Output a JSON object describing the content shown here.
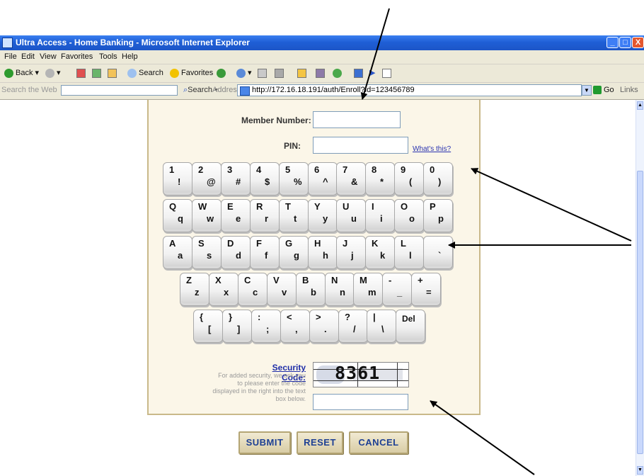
{
  "window": {
    "title": "Ultra Access - Home Banking - Microsoft Internet Explorer",
    "buttons": {
      "minimize": "_",
      "maximize": "□",
      "close": "X"
    }
  },
  "menu": [
    "File",
    "Edit",
    "View",
    "Favorites",
    "Tools",
    "Help"
  ],
  "toolbar": {
    "back": "Back",
    "search": "Search",
    "favorites": "Favorites"
  },
  "addressbar": {
    "search_web_placeholder": "Search the Web",
    "search_button": "Search",
    "address_label": "Address",
    "url": "http://172.16.18.191/auth/Enroll?id=123456789",
    "go": "Go",
    "links": "Links"
  },
  "form": {
    "member_number_label": "Member Number:",
    "pin_label": "PIN:",
    "whats_this": "What's this?",
    "security_code_label": "Security Code:",
    "security_code_desc": "For added security, we ask you to please enter the code displayed in the right into the text box below.",
    "captcha_text": "8361",
    "buttons": {
      "submit": "SUBMIT",
      "reset": "RESET",
      "cancel": "CANCEL"
    }
  },
  "keyboard": {
    "rows": [
      [
        [
          "1",
          "!"
        ],
        [
          "2",
          "@"
        ],
        [
          "3",
          "#"
        ],
        [
          "4",
          "$"
        ],
        [
          "5",
          "%"
        ],
        [
          "6",
          "^"
        ],
        [
          "7",
          "&"
        ],
        [
          "8",
          "*"
        ],
        [
          "9",
          "("
        ],
        [
          "0",
          ")"
        ]
      ],
      [
        [
          "Q",
          "q"
        ],
        [
          "W",
          "w"
        ],
        [
          "E",
          "e"
        ],
        [
          "R",
          "r"
        ],
        [
          "T",
          "t"
        ],
        [
          "Y",
          "y"
        ],
        [
          "U",
          "u"
        ],
        [
          "I",
          "i"
        ],
        [
          "O",
          "o"
        ],
        [
          "P",
          "p"
        ]
      ],
      [
        [
          "A",
          "a"
        ],
        [
          "S",
          "s"
        ],
        [
          "D",
          "d"
        ],
        [
          "F",
          "f"
        ],
        [
          "G",
          "g"
        ],
        [
          "H",
          "h"
        ],
        [
          "J",
          "j"
        ],
        [
          "K",
          "k"
        ],
        [
          "L",
          "l"
        ],
        [
          "",
          "`"
        ]
      ],
      [
        [
          "Z",
          "z"
        ],
        [
          "X",
          "x"
        ],
        [
          "C",
          "c"
        ],
        [
          "V",
          "v"
        ],
        [
          "B",
          "b"
        ],
        [
          "N",
          "n"
        ],
        [
          "M",
          "m"
        ],
        [
          "-",
          "_"
        ],
        [
          "+",
          "="
        ]
      ],
      [
        [
          "{",
          "["
        ],
        [
          "}",
          "]"
        ],
        [
          ":",
          ";"
        ],
        [
          "<",
          ","
        ],
        [
          ">",
          "."
        ],
        [
          "?",
          "/"
        ],
        [
          "|",
          "\\"
        ],
        [
          "Del",
          ""
        ]
      ]
    ]
  }
}
